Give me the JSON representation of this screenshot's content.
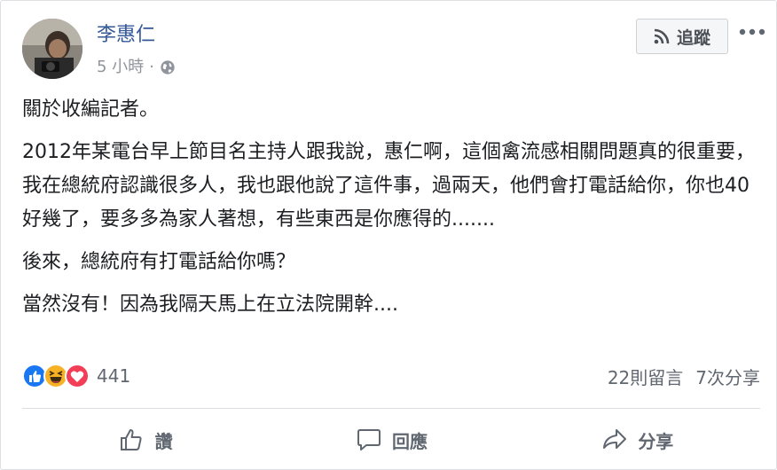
{
  "post": {
    "author": "李惠仁",
    "time": "5 小時",
    "separator": "·",
    "follow_label": "追蹤",
    "paragraphs": [
      "關於收編記者。",
      "2012年某電台早上節目名主持人跟我說，惠仁啊，這個禽流感相關問題真的很重要，我在總統府認識很多人，我也跟他說了這件事，過兩天，他們會打電話給你，你也40好幾了，要多多為家人著想，有些東西是你應得的.......",
      "後來，總統府有打電話給你嗎？",
      "當然沒有！因為我隔天馬上在立法院開幹...."
    ]
  },
  "stats": {
    "reaction_count": "441",
    "comments": "22則留言",
    "shares": "7次分享"
  },
  "actions": {
    "like": "讚",
    "comment": "回應",
    "share": "分享"
  },
  "colors": {
    "link": "#365899",
    "like_blue": "#1877f2",
    "haha_yellow": "#f7b125",
    "love_red": "#f33e58"
  }
}
